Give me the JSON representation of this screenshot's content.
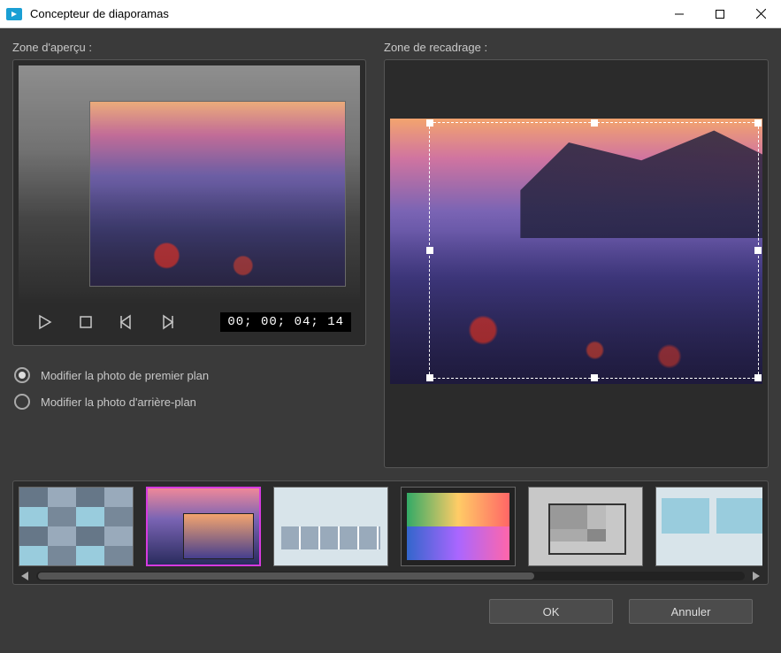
{
  "window": {
    "title": "Concepteur de diaporamas"
  },
  "labels": {
    "preview": "Zone d'aperçu :",
    "crop": "Zone de recadrage :"
  },
  "transport": {
    "timecode": "00; 00; 04; 14"
  },
  "options": {
    "foreground": "Modifier la photo de premier plan",
    "background": "Modifier la photo d'arrière-plan",
    "selected": "foreground"
  },
  "thumbnails": {
    "selected_index": 1,
    "count": 6
  },
  "footer": {
    "ok": "OK",
    "cancel": "Annuler"
  }
}
